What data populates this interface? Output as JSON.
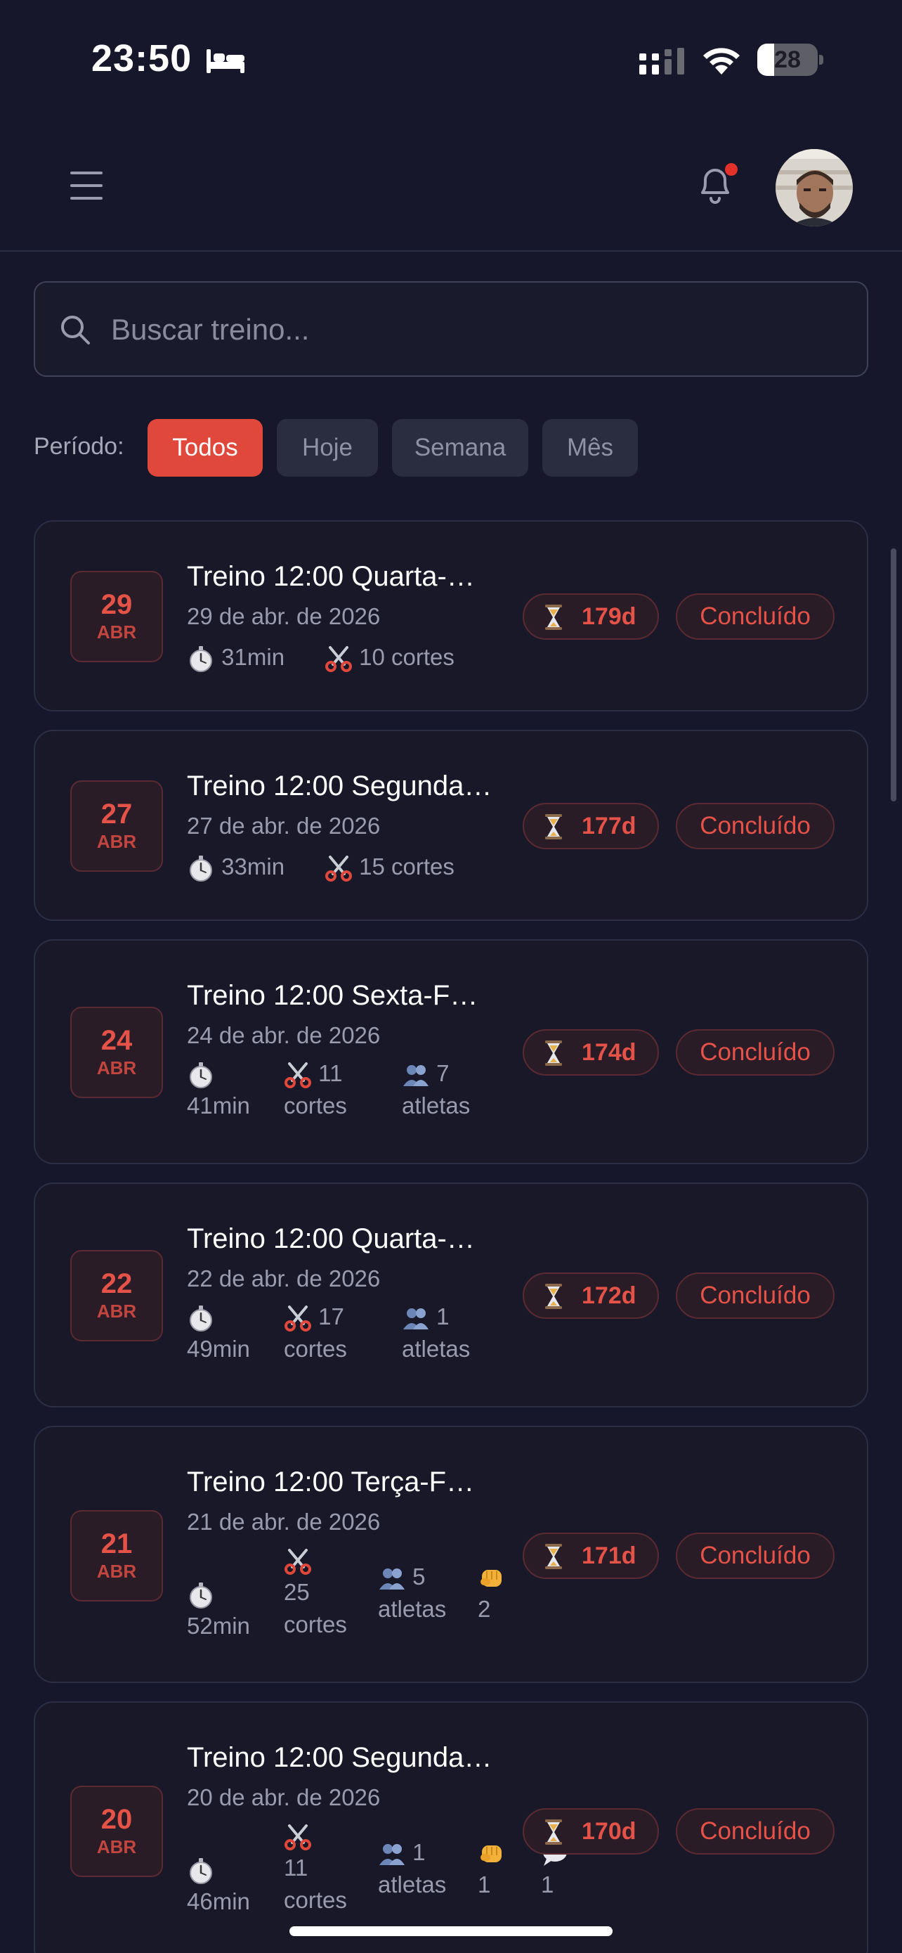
{
  "status_bar": {
    "time": "23:50",
    "battery": "28",
    "battery_level": 0.28,
    "icons": [
      "bed-icon",
      "cellular-signal-icon",
      "wifi-icon",
      "battery-icon"
    ]
  },
  "header": {
    "menu_icon": "hamburger-menu-icon",
    "bell_icon": "bell-icon",
    "has_notification": true,
    "avatar": "user-avatar"
  },
  "search": {
    "placeholder": "Buscar treino...",
    "value": ""
  },
  "filters": {
    "label": "Período:",
    "options": [
      "Todos",
      "Hoje",
      "Semana",
      "Mês"
    ],
    "selected": "Todos"
  },
  "colors": {
    "background": "#16172a",
    "accent": "#e0483c",
    "card": "#181828",
    "muted_text": "#9a9cae"
  },
  "trainings": [
    {
      "day": "29",
      "month": "ABR",
      "title": "Treino 12:00 Quarta-…",
      "date": "29 de abr. de 2026",
      "stats": {
        "duration": "31min",
        "cuts": "10 cortes"
      },
      "days": "179d",
      "status": "Concluído"
    },
    {
      "day": "27",
      "month": "ABR",
      "title": "Treino 12:00 Segunda…",
      "date": "27 de abr. de 2026",
      "stats": {
        "duration": "33min",
        "cuts": "15 cortes"
      },
      "days": "177d",
      "status": "Concluído"
    },
    {
      "day": "24",
      "month": "ABR",
      "title": "Treino 12:00 Sexta-F…",
      "date": "24 de abr. de 2026",
      "stats": {
        "duration": "41min",
        "cuts_num": "11",
        "cuts_word": "cortes",
        "athletes_num": "7",
        "athletes_word": "atletas"
      },
      "days": "174d",
      "status": "Concluído"
    },
    {
      "day": "22",
      "month": "ABR",
      "title": "Treino 12:00 Quarta-…",
      "date": "22 de abr. de 2026",
      "stats": {
        "duration": "49min",
        "cuts_num": "17",
        "cuts_word": "cortes",
        "athletes_num": "1",
        "athletes_word": "atletas"
      },
      "days": "172d",
      "status": "Concluído"
    },
    {
      "day": "21",
      "month": "ABR",
      "title": "Treino 12:00 Terça-F…",
      "date": "21 de abr. de 2026",
      "stats": {
        "duration": "52min",
        "cuts_num": "25",
        "cuts_word": "cortes",
        "athletes_num": "5",
        "athletes_word": "atletas",
        "punches": "2"
      },
      "days": "171d",
      "status": "Concluído"
    },
    {
      "day": "20",
      "month": "ABR",
      "title": "Treino 12:00 Segunda…",
      "date": "20 de abr. de 2026",
      "stats": {
        "duration": "46min",
        "cuts_num": "11",
        "cuts_word": "cortes",
        "athletes_num": "1",
        "athletes_word": "atletas",
        "punches": "1",
        "comments": "1"
      },
      "days": "170d",
      "status": "Concluído"
    }
  ]
}
